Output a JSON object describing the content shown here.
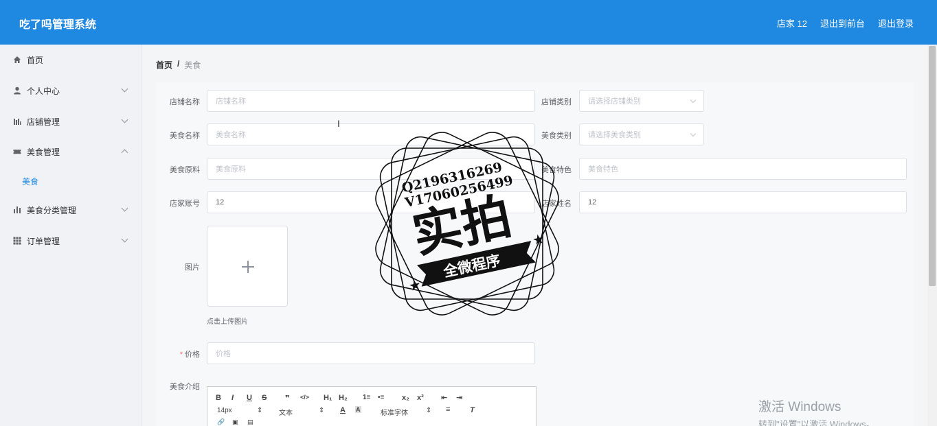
{
  "app": {
    "title": "吃了吗管理系统"
  },
  "header": {
    "user": "店家 12",
    "to_front": "退出到前台",
    "logout": "退出登录"
  },
  "sidebar": {
    "items": [
      {
        "label": "首页",
        "icon": "home-icon"
      },
      {
        "label": "个人中心",
        "icon": "user-icon"
      },
      {
        "label": "店铺管理",
        "icon": "chart-icon"
      },
      {
        "label": "美食管理",
        "icon": "ticket-icon"
      },
      {
        "label": "美食",
        "icon": ""
      },
      {
        "label": "美食分类管理",
        "icon": "bar-chart-icon"
      },
      {
        "label": "订单管理",
        "icon": "grid-icon"
      }
    ]
  },
  "breadcrumb": {
    "home": "首页",
    "separator": "/",
    "current": "美食"
  },
  "form": {
    "shop_name": {
      "label": "店铺名称",
      "placeholder": "店铺名称"
    },
    "shop_type": {
      "label": "店铺类别",
      "placeholder": "请选择店铺类别"
    },
    "food_name": {
      "label": "美食名称",
      "placeholder": "美食名称"
    },
    "food_type": {
      "label": "美食类别",
      "placeholder": "请选择美食类别"
    },
    "ingredients": {
      "label": "美食原料",
      "placeholder": "美食原料"
    },
    "feature": {
      "label": "美食特色",
      "placeholder": "美食特色"
    },
    "account": {
      "label": "店家账号",
      "value": "12"
    },
    "owner_name": {
      "label": "店家姓名",
      "value": "12"
    },
    "image": {
      "label": "图片",
      "tip": "点击上传图片"
    },
    "price": {
      "label": "价格",
      "required": "*",
      "placeholder": "价格"
    },
    "intro": {
      "label": "美食介绍"
    }
  },
  "editor": {
    "font_size": "14px",
    "text_style": "文本",
    "font_family": "标准字体",
    "buttons": [
      "B",
      "I",
      "U",
      "S",
      "❞",
      "</>",
      "H₁",
      "H₂",
      "1≡",
      "•≡",
      "x₂",
      "x²",
      "⇤",
      "⇥"
    ]
  },
  "stamp": {
    "line1": "Q2196316269",
    "line2": "V17060256499",
    "main": "实拍",
    "banner": "全微程序"
  },
  "os_watermark": {
    "line1": "激活 Windows",
    "line2": "转到\"设置\"以激活 Windows。"
  },
  "colors": {
    "header_bg": "#1f88e0",
    "active_menu": "#1f88e0"
  }
}
